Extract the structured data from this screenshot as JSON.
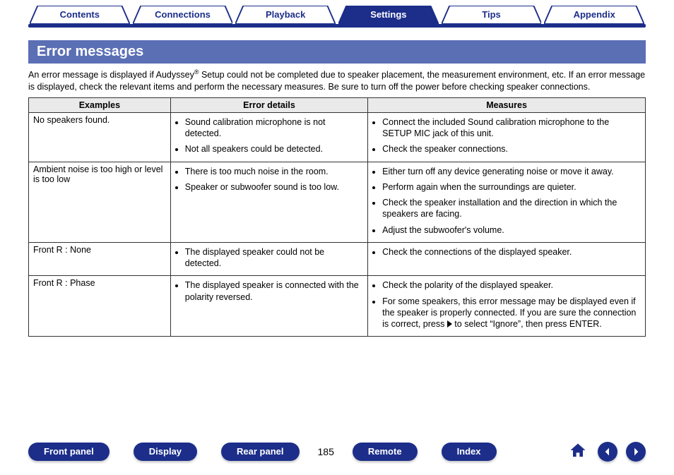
{
  "tabs": [
    {
      "label": "Contents",
      "active": false
    },
    {
      "label": "Connections",
      "active": false
    },
    {
      "label": "Playback",
      "active": false
    },
    {
      "label": "Settings",
      "active": true
    },
    {
      "label": "Tips",
      "active": false
    },
    {
      "label": "Appendix",
      "active": false
    }
  ],
  "section_title": "Error messages",
  "intro_html": "An error message is displayed if Audyssey<sup>®</sup> Setup could not be completed due to speaker placement, the measurement environment, etc. If an error message is displayed, check the relevant items and perform the necessary measures. Be sure to turn off the power before checking speaker connections.",
  "table": {
    "headers": [
      "Examples",
      "Error details",
      "Measures"
    ],
    "rows": [
      {
        "example": "No speakers found.",
        "details": [
          "Sound calibration microphone is not detected.",
          "Not all speakers could be detected."
        ],
        "measures": [
          "Connect the included Sound calibration microphone to the SETUP MIC jack of this unit.",
          "Check the speaker connections."
        ]
      },
      {
        "example": "Ambient noise is too high or level is too low",
        "details": [
          "There is too much noise in the room.",
          "Speaker or subwoofer sound is too low."
        ],
        "measures": [
          "Either turn off any device generating noise or move it away.",
          "Perform again when the surroundings are quieter.",
          "Check the speaker installation and the direction in which the speakers are facing.",
          "Adjust the subwoofer's volume."
        ]
      },
      {
        "example": "Front R : None",
        "details": [
          "The displayed speaker could not be detected."
        ],
        "measures": [
          "Check the connections of the displayed speaker."
        ]
      },
      {
        "example": "Front R : Phase",
        "details": [
          "The displayed speaker is connected with the polarity reversed."
        ],
        "measures": [
          "Check the polarity of the displayed speaker.",
          "For some speakers, this error message may be displayed even if the speaker is properly connected. If you are sure the connection is correct, press {TRI} to select “Ignore”, then press ENTER."
        ]
      }
    ]
  },
  "bottom": {
    "buttons": [
      "Front panel",
      "Display",
      "Rear panel"
    ],
    "page_number": "185",
    "buttons2": [
      "Remote",
      "Index"
    ]
  }
}
